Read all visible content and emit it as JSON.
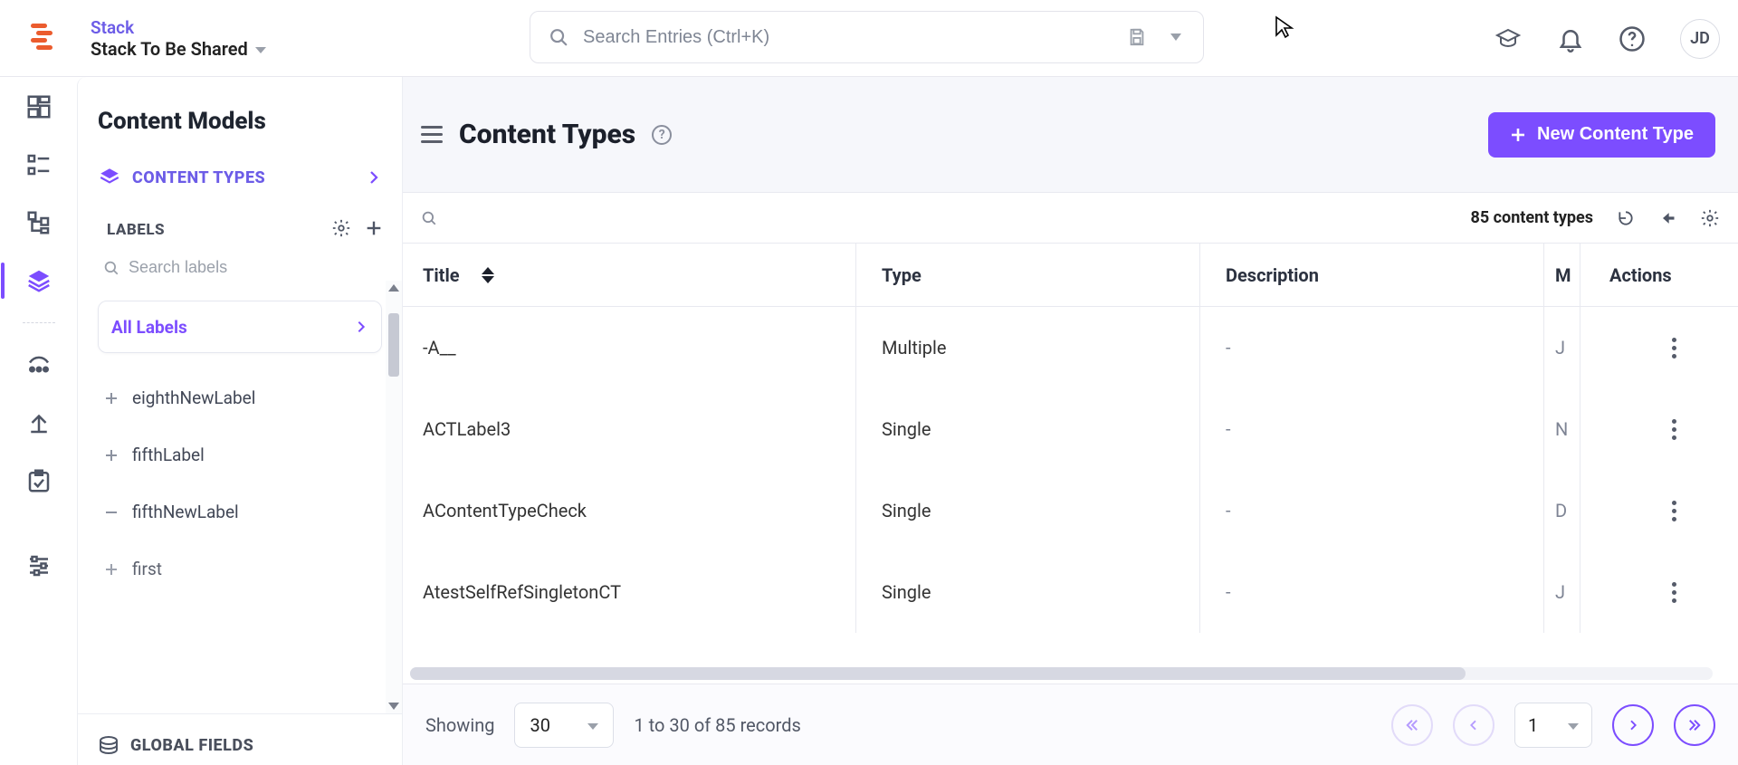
{
  "header": {
    "stack_label": "Stack",
    "stack_name": "Stack To Be Shared",
    "search_placeholder": "Search Entries (Ctrl+K)",
    "user_initials": "JD"
  },
  "rail": {
    "items": [
      {
        "id": "dashboard"
      },
      {
        "id": "entries"
      },
      {
        "id": "tree"
      },
      {
        "id": "models",
        "active": true
      },
      {
        "id": "releases"
      },
      {
        "id": "publish"
      },
      {
        "id": "tasks"
      },
      {
        "id": "settings"
      }
    ]
  },
  "sidebar": {
    "title": "Content Models",
    "content_types_label": "CONTENT TYPES",
    "labels_title": "LABELS",
    "labels_search_placeholder": "Search labels",
    "all_labels": "All Labels",
    "labels": [
      {
        "text": "eighthNewLabel",
        "icon": "plus"
      },
      {
        "text": "fifthLabel",
        "icon": "plus"
      },
      {
        "text": "fifthNewLabel",
        "icon": "minus"
      },
      {
        "text": "first",
        "icon": "plus",
        "truncated": true
      }
    ],
    "global_fields": "GLOBAL FIELDS"
  },
  "page": {
    "title": "Content Types",
    "new_button": "New Content Type",
    "count_text": "85 content types",
    "columns": {
      "title": "Title",
      "type": "Type",
      "description": "Description",
      "m": "M",
      "actions": "Actions"
    },
    "rows": [
      {
        "title": "-A__",
        "type": "Multiple",
        "description": "-",
        "m": "J"
      },
      {
        "title": "ACTLabel3",
        "type": "Single",
        "description": "-",
        "m": "N"
      },
      {
        "title": "AContentTypeCheck",
        "type": "Single",
        "description": "-",
        "m": "D"
      },
      {
        "title": "AtestSelfRefSingletonCT",
        "type": "Single",
        "description": "-",
        "m": "J"
      }
    ],
    "pagination": {
      "showing_label": "Showing",
      "page_size": "30",
      "range_text": "1 to 30 of 85 records",
      "current_page": "1"
    }
  }
}
